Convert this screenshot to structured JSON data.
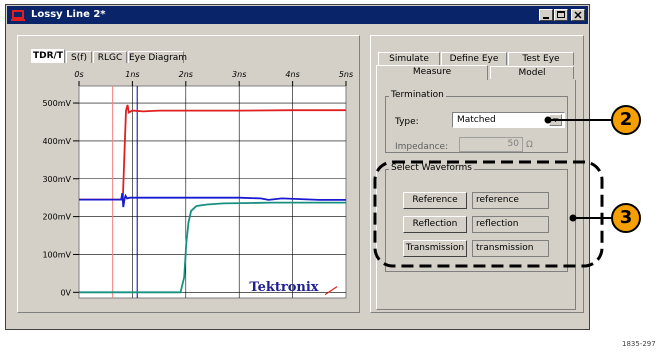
{
  "window": {
    "title": "Lossy Line 2*"
  },
  "left_tabs": [
    "TDR/T",
    "S(f)",
    "RLGC",
    "Eye Diagram"
  ],
  "right_tabs_back": [
    "Simulate",
    "Define Eye",
    "Test Eye"
  ],
  "right_tabs_front": [
    "Measure",
    "Model"
  ],
  "termination": {
    "group_label": "Termination",
    "type_label": "Type:",
    "type_value": "Matched",
    "impedance_label": "Impedance:",
    "impedance_value": "50",
    "impedance_unit": "Ω"
  },
  "waveforms": {
    "group_label": "Select Waveforms",
    "rows": [
      {
        "button": "Reference",
        "value": "reference"
      },
      {
        "button": "Reflection",
        "value": "reflection"
      },
      {
        "button": "Transmission",
        "value": "transmission"
      }
    ]
  },
  "callouts": [
    "2",
    "3"
  ],
  "figure_id": "1835-297",
  "logo": "Tektronix",
  "colors": {
    "red": "#e02020",
    "blue": "#1a1ad0",
    "teal": "#189080",
    "marker_red": "#f08080",
    "marker_blue": "#0000c0",
    "callout": "#f5a000",
    "titlebar": "#0a246a"
  },
  "chart_data": {
    "type": "line",
    "x_ticks": [
      "0s",
      "1ns",
      "2ns",
      "3ns",
      "4ns",
      "5ns"
    ],
    "y_ticks": [
      "500mV",
      "400mV",
      "300mV",
      "200mV",
      "100mV",
      "0V"
    ],
    "xlim": [
      0,
      5
    ],
    "ylim": [
      -15,
      545
    ],
    "grid": true,
    "series": [
      {
        "color": "red",
        "x": [
          0,
          0.75,
          0.82,
          0.86,
          0.88,
          0.91,
          0.93,
          1.0,
          1.2,
          1.5,
          2.0,
          3.0,
          4.0,
          5.0
        ],
        "y": [
          245,
          245,
          245,
          400,
          480,
          495,
          475,
          480,
          478,
          480,
          480,
          480,
          481,
          481
        ]
      },
      {
        "color": "blue",
        "x": [
          0,
          0.79,
          0.81,
          0.83,
          0.85,
          0.87,
          0.9,
          0.95,
          1.05,
          1.5,
          2.0,
          3.0,
          3.4,
          3.55,
          3.8,
          4.5,
          5.0
        ],
        "y": [
          245,
          245,
          262,
          225,
          245,
          255,
          248,
          250,
          250,
          250,
          250,
          250,
          248,
          244,
          248,
          244,
          244
        ]
      },
      {
        "color": "teal",
        "x": [
          0,
          1.9,
          1.97,
          2.01,
          2.05,
          2.1,
          2.2,
          2.4,
          2.7,
          3.2,
          3.6,
          4.0,
          5.0
        ],
        "y": [
          0,
          0,
          40,
          130,
          185,
          215,
          228,
          232,
          235,
          236,
          237,
          237,
          237
        ]
      }
    ],
    "markers": [
      {
        "color": "marker_red",
        "x": 0.63
      },
      {
        "color": "marker_blue",
        "x": 1.09
      }
    ]
  }
}
